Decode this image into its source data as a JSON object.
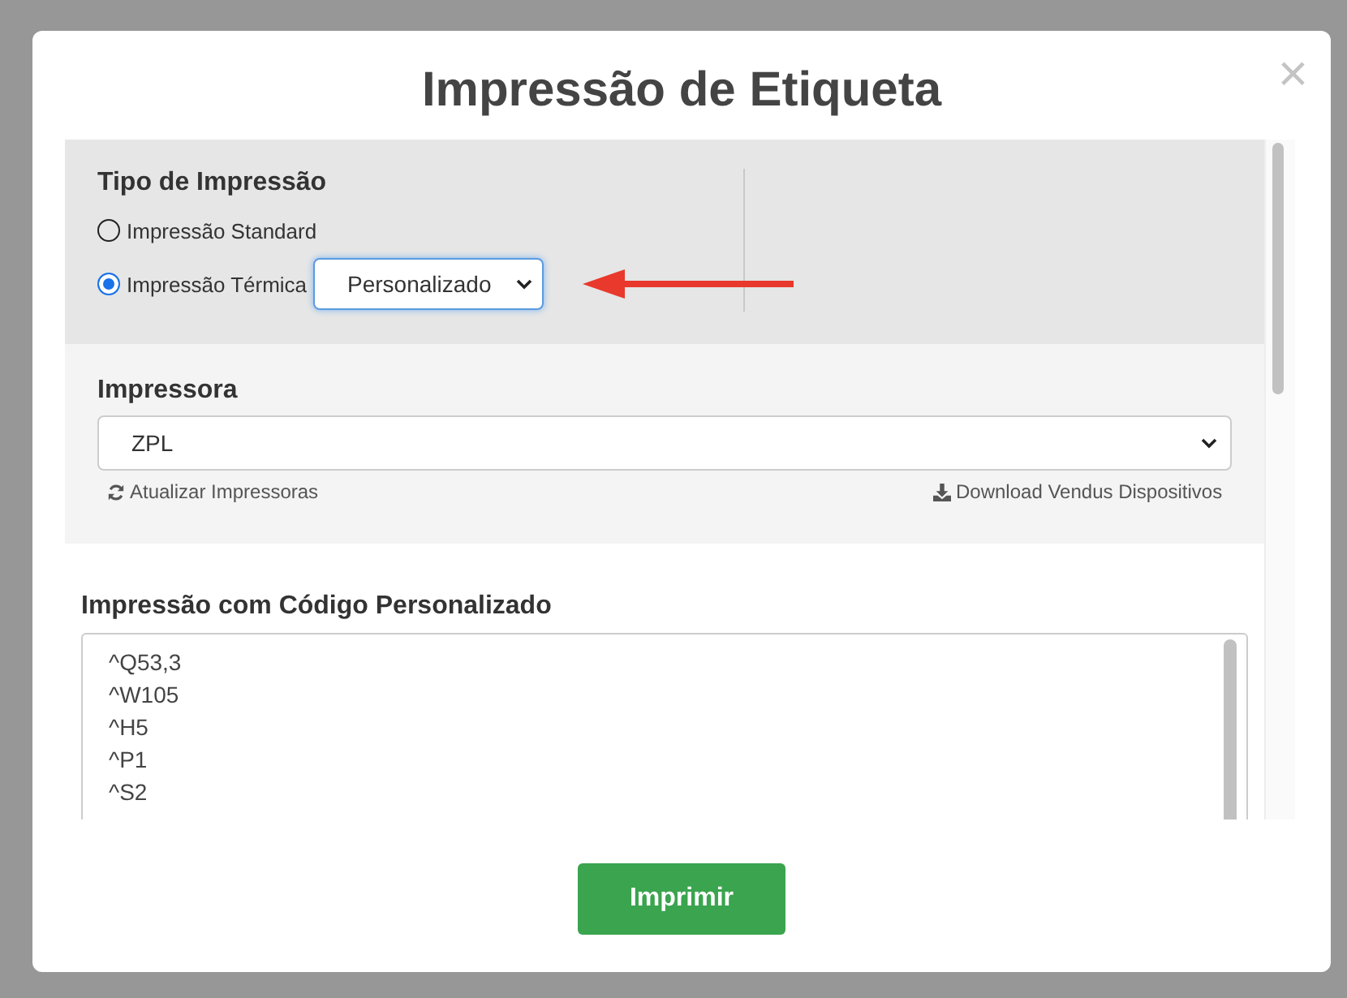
{
  "modal": {
    "title": "Impressão de Etiqueta",
    "close": "×"
  },
  "print_type": {
    "label": "Tipo de Impressão",
    "options": [
      {
        "label": "Impressão Standard",
        "selected": false
      },
      {
        "label": "Impressão Térmica",
        "selected": true
      }
    ],
    "thermal_select": {
      "value": "Personalizado"
    }
  },
  "printer": {
    "label": "Impressora",
    "value": "ZPL",
    "refresh_link": "Atualizar Impressoras",
    "download_link": "Download Vendus Dispositivos"
  },
  "custom_code": {
    "label": "Impressão com Código Personalizado",
    "lines": [
      "^Q53,3",
      "^W105",
      "^H5",
      "^P1",
      "^S2"
    ]
  },
  "print_button": "Imprimir"
}
